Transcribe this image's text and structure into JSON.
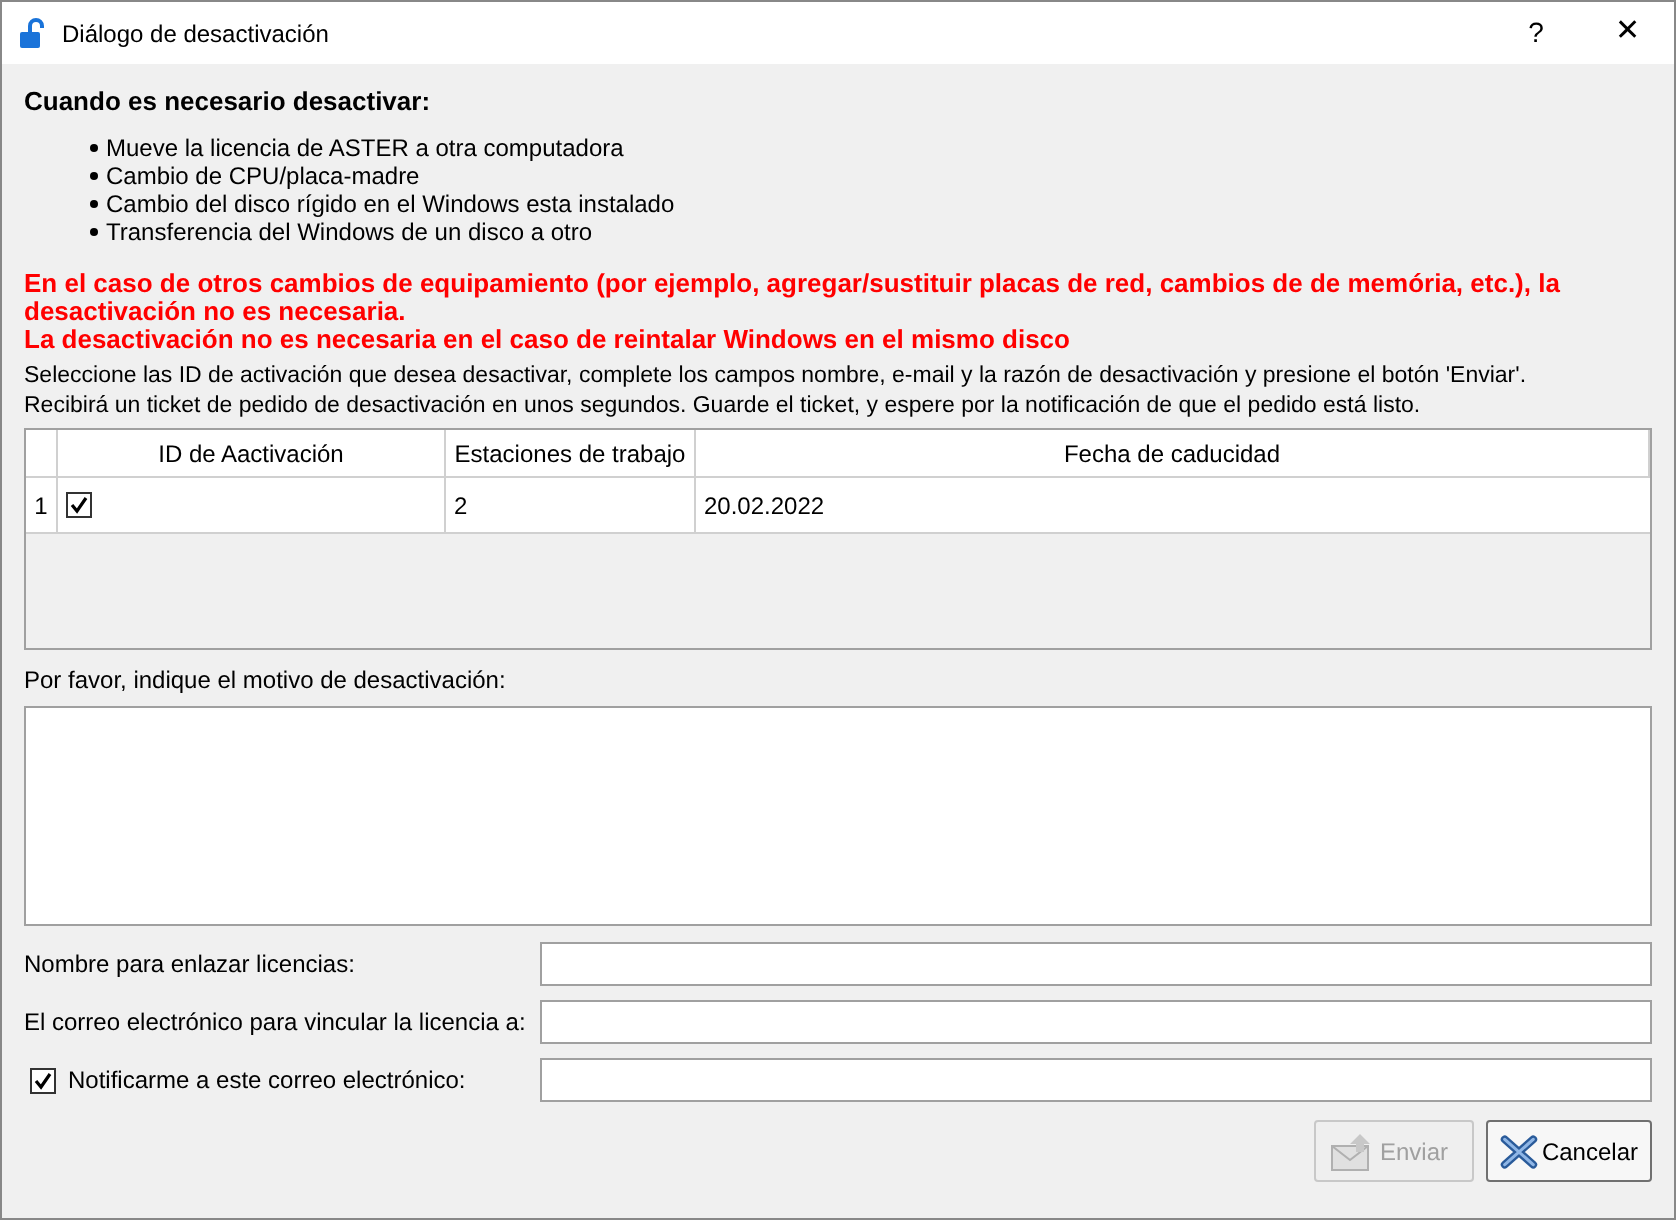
{
  "window": {
    "title": "Diálogo de desactivación",
    "help": "?",
    "close": "✕"
  },
  "heading": "Cuando es necesario desactivar:",
  "bullets": [
    "Mueve la licencia de ASTER a otra computadora",
    "Cambio de CPU/placa-madre",
    "Cambio del disco rígido en el Windows esta instalado",
    "Transferencia del Windows de un disco a otro"
  ],
  "warnings": [
    "En el caso de otros cambios de equipamiento (por ejemplo, agregar/sustituir placas de red, cambios de de memória, etc.), la desactivación no es necesaria.",
    "La desactivación no es necesaria en el caso de reintalar Windows en el mismo disco"
  ],
  "instructions": [
    "Seleccione las ID de activación que desea desactivar, complete los campos nombre, e-mail y la razón de desactivación y presione el botón 'Enviar'.",
    "Recibirá un ticket de pedido de desactivación en unos segundos. Guarde el ticket, y espere por la notificación de que el pedido está listo."
  ],
  "table": {
    "columns": [
      "ID de Aactivación",
      "Estaciones de trabajo",
      "Fecha de caducidad"
    ],
    "rows": [
      {
        "number": "1",
        "checked": true,
        "workstations": "2",
        "expiry": "20.02.2022"
      }
    ]
  },
  "reason_label": "Por favor, indique el motivo de desactivación:",
  "fields": [
    {
      "kind": "label",
      "label": "Nombre para enlazar licencias:"
    },
    {
      "kind": "label",
      "label": "El correo electrónico para vincular la licencia a:"
    },
    {
      "kind": "checkbox",
      "label": "Notificarme a este correo electrónico:",
      "checked": true
    }
  ],
  "buttons": [
    {
      "kind": "send",
      "label": "Enviar",
      "disabled": true
    },
    {
      "kind": "cancel",
      "label": "Cancelar",
      "disabled": false
    }
  ]
}
